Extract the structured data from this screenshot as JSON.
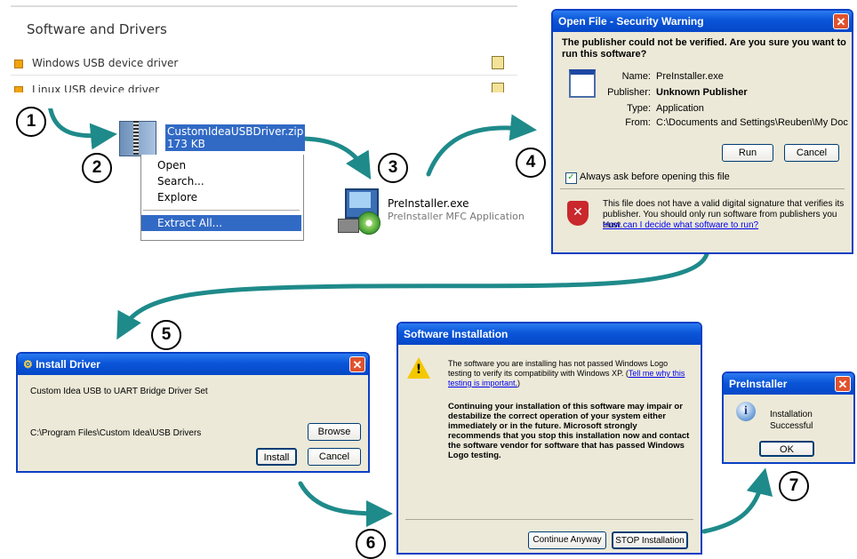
{
  "software_panel": {
    "title": "Software and Drivers",
    "rows": [
      {
        "label": "Windows USB device driver"
      },
      {
        "label": "Linux USB device driver"
      }
    ]
  },
  "steps": [
    "1",
    "2",
    "3",
    "4",
    "5",
    "6",
    "7"
  ],
  "zip_file": {
    "name": "CustomIdeaUSBDriver.zip",
    "size": "173 KB"
  },
  "context_menu": {
    "items": [
      "Open",
      "Search...",
      "Explore",
      "Extract All..."
    ]
  },
  "preinstaller": {
    "name": "PreInstaller.exe",
    "desc": "PreInstaller MFC Application"
  },
  "security_warning": {
    "title": "Open File - Security Warning",
    "question": "The publisher could not be verified.  Are you sure you want to run this software?",
    "name_label": "Name:",
    "name_value": "PreInstaller.exe",
    "publisher_label": "Publisher:",
    "publisher_value": "Unknown Publisher",
    "type_label": "Type:",
    "type_value": "Application",
    "from_label": "From:",
    "from_value": "C:\\Documents and Settings\\Reuben\\My Document...",
    "run_button": "Run",
    "cancel_button": "Cancel",
    "checkbox_label": "Always ask before opening this file",
    "footer_text": "This file does not have a valid digital signature that verifies its publisher.  You should only run software from publishers you trust.",
    "footer_link": "How can I decide what software to run?"
  },
  "install_driver": {
    "title": "Install Driver",
    "description": "Custom Idea USB to UART Bridge Driver Set",
    "path": "C:\\Program Files\\Custom Idea\\USB Drivers",
    "browse_button": "Browse",
    "install_button": "Install",
    "cancel_button": "Cancel"
  },
  "software_installation": {
    "title": "Software Installation",
    "message_pre": "The software you are installing has not passed Windows Logo testing to verify its compatibility with Windows XP. (",
    "message_link": "Tell me why this testing is important.",
    "message_post": ")",
    "warning": "Continuing your installation of this software may impair or destabilize the correct operation of your system either immediately or in the future. Microsoft strongly recommends that you stop this installation now and contact the software vendor for software that has passed Windows Logo testing.",
    "continue_button": "Continue Anyway",
    "stop_button": "STOP Installation"
  },
  "preinstaller_dialog": {
    "title": "PreInstaller",
    "message": "Installation Successful",
    "ok_button": "OK"
  },
  "colors": {
    "arrow": "#1f8a8a",
    "xp_title": "#0a55d8",
    "highlight": "#316ac5"
  }
}
